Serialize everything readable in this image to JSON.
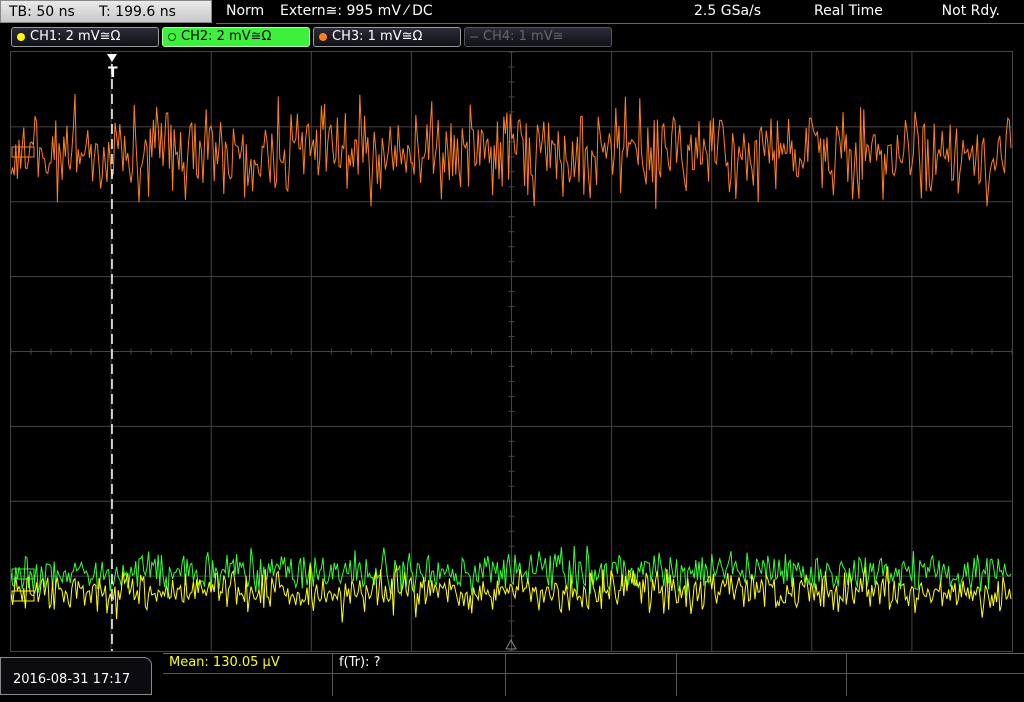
{
  "timebase": {
    "tb": "TB: 50 ns",
    "t": "T: 199.6 ns"
  },
  "status": {
    "mode": "Norm",
    "trigger": "Extern≅: 995 mV ⁄ DC",
    "sample_rate": "2.5 GSa/s",
    "acq": "Real Time",
    "state": "Not Rdy."
  },
  "channels": [
    {
      "label": "CH1: 2 mV≅Ω",
      "color": "#ffff00",
      "state": "on"
    },
    {
      "label": "CH2: 2 mV≅Ω",
      "color": "#33ff33",
      "state": "selected"
    },
    {
      "label": "CH3: 1 mV≅Ω",
      "color": "#ff7f1e",
      "state": "on"
    },
    {
      "label": "CH4: 1 mV≅",
      "color": "#666666",
      "state": "off"
    }
  ],
  "trigger_marker": "T",
  "date": "2016-08-31 17:17",
  "measurements": {
    "mean": "Mean: 130.05 µV",
    "ftr": "f(Tr): ?"
  },
  "colors": {
    "ch1": "#ffff00",
    "ch2": "#33ff33",
    "ch3": "#ff7f1e",
    "grid": "#444444"
  }
}
